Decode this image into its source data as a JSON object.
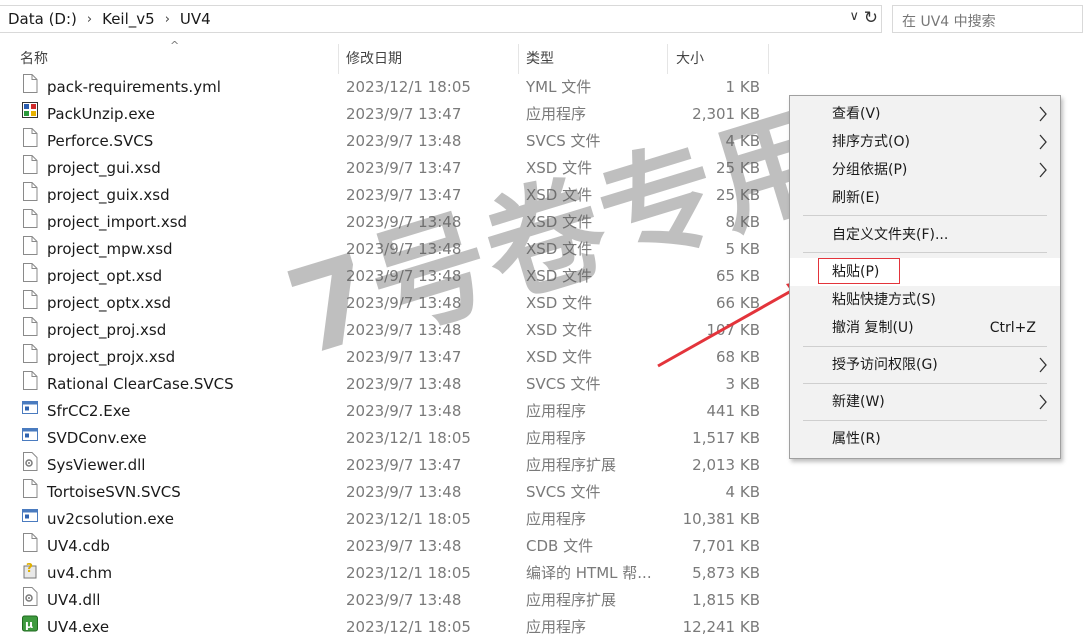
{
  "breadcrumb": [
    "Data (D:)",
    "Keil_v5",
    "UV4"
  ],
  "search_placeholder": "在 UV4 中搜索",
  "columns": {
    "name": "名称",
    "date": "修改日期",
    "type": "类型",
    "size": "大小"
  },
  "files": [
    {
      "name": "pack-requirements.yml",
      "date": "2023/12/1 18:05",
      "type": "YML 文件",
      "size": "1 KB",
      "icon": "document"
    },
    {
      "name": "PackUnzip.exe",
      "date": "2023/9/7 13:47",
      "type": "应用程序",
      "size": "2,301 KB",
      "icon": "app-colorful"
    },
    {
      "name": "Perforce.SVCS",
      "date": "2023/9/7 13:48",
      "type": "SVCS 文件",
      "size": "4 KB",
      "icon": "document"
    },
    {
      "name": "project_gui.xsd",
      "date": "2023/9/7 13:47",
      "type": "XSD 文件",
      "size": "25 KB",
      "icon": "document"
    },
    {
      "name": "project_guix.xsd",
      "date": "2023/9/7 13:47",
      "type": "XSD 文件",
      "size": "25 KB",
      "icon": "document"
    },
    {
      "name": "project_import.xsd",
      "date": "2023/9/7 13:48",
      "type": "XSD 文件",
      "size": "8 KB",
      "icon": "document"
    },
    {
      "name": "project_mpw.xsd",
      "date": "2023/9/7 13:48",
      "type": "XSD 文件",
      "size": "5 KB",
      "icon": "document"
    },
    {
      "name": "project_opt.xsd",
      "date": "2023/9/7 13:48",
      "type": "XSD 文件",
      "size": "65 KB",
      "icon": "document"
    },
    {
      "name": "project_optx.xsd",
      "date": "2023/9/7 13:48",
      "type": "XSD 文件",
      "size": "66 KB",
      "icon": "document"
    },
    {
      "name": "project_proj.xsd",
      "date": "2023/9/7 13:48",
      "type": "XSD 文件",
      "size": "107 KB",
      "icon": "document"
    },
    {
      "name": "project_projx.xsd",
      "date": "2023/9/7 13:47",
      "type": "XSD 文件",
      "size": "68 KB",
      "icon": "document"
    },
    {
      "name": "Rational ClearCase.SVCS",
      "date": "2023/9/7 13:48",
      "type": "SVCS 文件",
      "size": "3 KB",
      "icon": "document"
    },
    {
      "name": "SfrCC2.Exe",
      "date": "2023/9/7 13:48",
      "type": "应用程序",
      "size": "441 KB",
      "icon": "app-window"
    },
    {
      "name": "SVDConv.exe",
      "date": "2023/12/1 18:05",
      "type": "应用程序",
      "size": "1,517 KB",
      "icon": "app-window"
    },
    {
      "name": "SysViewer.dll",
      "date": "2023/9/7 13:47",
      "type": "应用程序扩展",
      "size": "2,013 KB",
      "icon": "dll"
    },
    {
      "name": "TortoiseSVN.SVCS",
      "date": "2023/9/7 13:48",
      "type": "SVCS 文件",
      "size": "4 KB",
      "icon": "document"
    },
    {
      "name": "uv2csolution.exe",
      "date": "2023/12/1 18:05",
      "type": "应用程序",
      "size": "10,381 KB",
      "icon": "app-window"
    },
    {
      "name": "UV4.cdb",
      "date": "2023/9/7 13:48",
      "type": "CDB 文件",
      "size": "7,701 KB",
      "icon": "document"
    },
    {
      "name": "uv4.chm",
      "date": "2023/12/1 18:05",
      "type": "编译的 HTML 帮...",
      "size": "5,873 KB",
      "icon": "chm"
    },
    {
      "name": "UV4.dll",
      "date": "2023/9/7 13:48",
      "type": "应用程序扩展",
      "size": "1,815 KB",
      "icon": "dll"
    },
    {
      "name": "UV4.exe",
      "date": "2023/12/1 18:05",
      "type": "应用程序",
      "size": "12,241 KB",
      "icon": "keil"
    }
  ],
  "watermark": "7号卷专用",
  "context_menu": {
    "view": "查看(V)",
    "sort_by": "排序方式(O)",
    "group_by": "分组依据(P)",
    "refresh": "刷新(E)",
    "customize": "自定义文件夹(F)...",
    "paste": "粘贴(P)",
    "paste_shortcut": "粘贴快捷方式(S)",
    "undo_copy": "撤消 复制(U)",
    "undo_shortcut": "Ctrl+Z",
    "give_access": "授予访问权限(G)",
    "new": "新建(W)",
    "properties": "属性(R)"
  },
  "colors": {
    "highlight_border": "#e3343b",
    "arrow": "#e3343b"
  }
}
